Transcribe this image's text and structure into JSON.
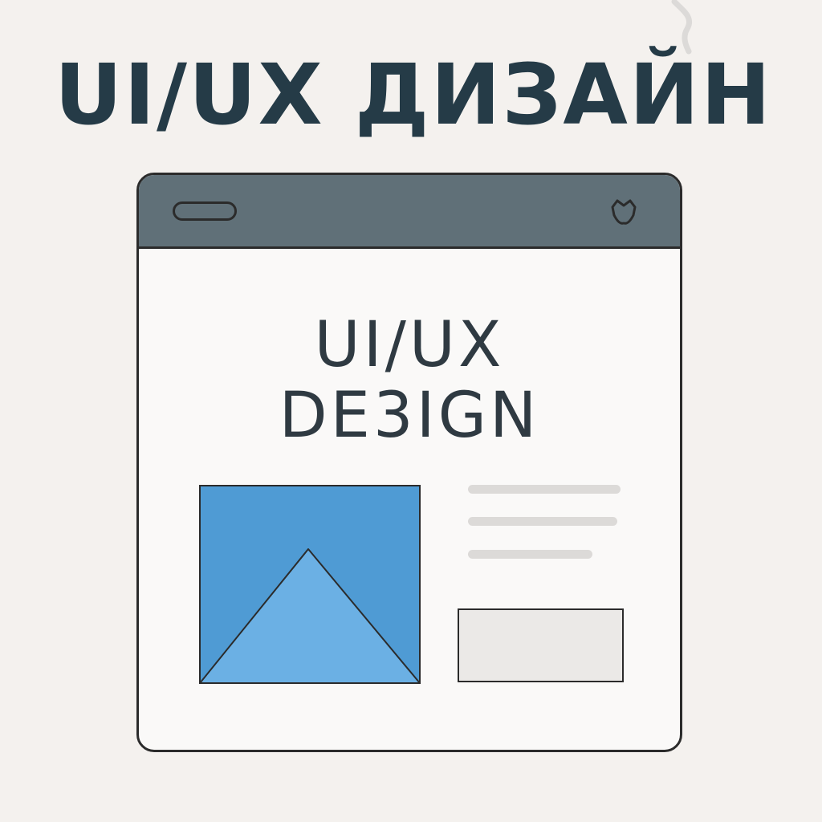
{
  "heading": "UI/UX ДИЗАЙН",
  "window": {
    "title_line1": "UI/UX",
    "title_line2": "DE3IGN",
    "icons": {
      "menu": "pill-icon",
      "corner": "fox-icon",
      "image": "image-placeholder-icon"
    }
  },
  "colors": {
    "background": "#f4f1ee",
    "heading": "#253b47",
    "titlebar": "#607078",
    "image_bg": "#4f9bd4",
    "image_mountain": "#6bb0e4"
  }
}
